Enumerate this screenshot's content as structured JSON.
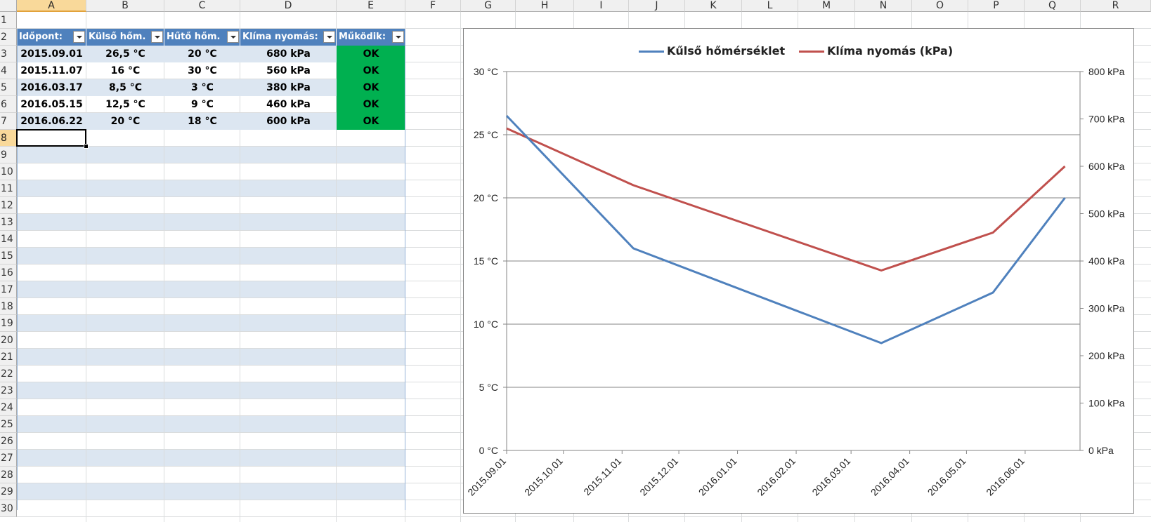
{
  "columns": [
    "A",
    "B",
    "C",
    "D",
    "E",
    "F",
    "G",
    "H",
    "I",
    "J",
    "K",
    "L",
    "M",
    "N",
    "O",
    "P",
    "Q",
    "R"
  ],
  "rows": [
    "1",
    "2",
    "3",
    "4",
    "5",
    "6",
    "7",
    "8",
    "9",
    "10",
    "11",
    "12",
    "13",
    "14",
    "15",
    "16",
    "17",
    "18",
    "19",
    "20",
    "21",
    "22",
    "23",
    "24",
    "25",
    "26",
    "27",
    "28",
    "29",
    "30"
  ],
  "selected_cell": {
    "column": "A",
    "row": "8"
  },
  "table": {
    "headers": [
      "Időpont:",
      "Külső hőm.",
      "Hűtő hőm.",
      "Klíma nyomás:",
      "Működik:"
    ],
    "rows": [
      [
        "2015.09.01",
        "26,5 °C",
        "20 °C",
        "680 kPa",
        "OK"
      ],
      [
        "2015.11.07",
        "16 °C",
        "30 °C",
        "560 kPa",
        "OK"
      ],
      [
        "2016.03.17",
        "8,5 °C",
        "3 °C",
        "380 kPa",
        "OK"
      ],
      [
        "2016.05.15",
        "12,5 °C",
        "9 °C",
        "460 kPa",
        "OK"
      ],
      [
        "2016.06.22",
        "20 °C",
        "18 °C",
        "600 kPa",
        "OK"
      ]
    ]
  },
  "colors": {
    "header_bg": "#4f81bd",
    "band_bg": "#dce6f1",
    "ok_bg": "#00b050",
    "series1": "#4f81bd",
    "series2": "#c0504d"
  },
  "chart_data": {
    "type": "line",
    "legend_position": "top",
    "grid": true,
    "series": [
      {
        "name": "Kűlső hőmérséklet",
        "axis": "left",
        "x": [
          "2015.09.01",
          "2015.11.07",
          "2016.03.17",
          "2016.05.15",
          "2016.06.22"
        ],
        "values": [
          26.5,
          16,
          8.5,
          12.5,
          20
        ]
      },
      {
        "name": "Klíma nyomás (kPa)",
        "axis": "right",
        "x": [
          "2015.09.01",
          "2015.11.07",
          "2016.03.17",
          "2016.05.15",
          "2016.06.22"
        ],
        "values": [
          680,
          560,
          380,
          460,
          600
        ]
      }
    ],
    "x_ticks": [
      "2015.09.01",
      "2015.10.01",
      "2015.11.01",
      "2015.12.01",
      "2016.01.01",
      "2016.02.01",
      "2016.03.01",
      "2016.04.01",
      "2016.05.01",
      "2016.06.01"
    ],
    "xlim": [
      "2015.09.01",
      "2016.06.30"
    ],
    "y_left_ticks": [
      "0 °C",
      "5 °C",
      "10 °C",
      "15 °C",
      "20 °C",
      "25 °C",
      "30 °C"
    ],
    "y_left_lim": [
      0,
      30
    ],
    "y_right_ticks": [
      "0 kPa",
      "100 kPa",
      "200 kPa",
      "300 kPa",
      "400 kPa",
      "500 kPa",
      "600 kPa",
      "700 kPa",
      "800 kPa"
    ],
    "y_right_lim": [
      0,
      800
    ]
  }
}
